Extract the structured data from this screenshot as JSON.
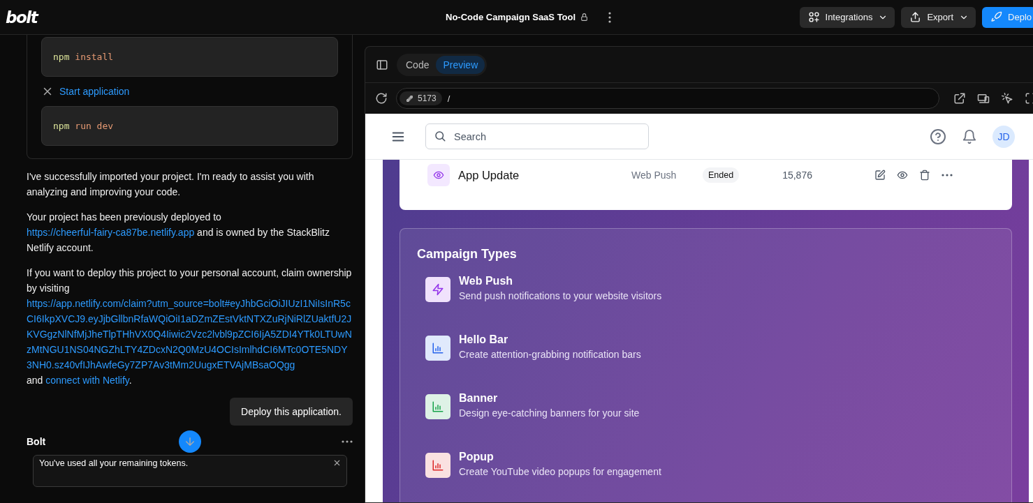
{
  "topbar": {
    "logo": "bolt",
    "project_title": "No-Code Campaign SaaS Tool",
    "buttons": [
      {
        "label": "Integrations",
        "kind": "menu"
      },
      {
        "label": "Export",
        "kind": "menu"
      },
      {
        "label": "Deplo",
        "kind": "primary"
      }
    ]
  },
  "chat": {
    "action_card": {
      "steps": [
        {
          "kind": "command",
          "command": "npm",
          "args": "install"
        },
        {
          "kind": "action",
          "label": "Start application"
        },
        {
          "kind": "command",
          "command": "npm",
          "args": "run dev"
        }
      ]
    },
    "assistant_paragraphs": [
      [
        {
          "text": "I've successfully imported your project. I'm ready to assist you with analyzing and improving your code."
        }
      ],
      [
        {
          "text": "Your project has been previously deployed to "
        },
        {
          "link": "https://cheerful-fairy-ca87be.netlify.app"
        },
        {
          "text": " and is owned by the StackBlitz Netlify account."
        }
      ],
      [
        {
          "text": "If you want to deploy this project to your personal account, claim ownership by visiting "
        },
        {
          "link": "https://app.netlify.com/claim?utm_source=bolt#eyJhbGciOiJIUzI1NiIsInR5cCI6IkpXVCJ9.eyJjbGllbnRfaWQiOiI1aDZmZEstVktNTXZuRjNiRlZUaktfU2JKVGgzNlNfMjJheTlpTHhVX0Q4Iiwic2Vzc2lvbl9pZCI6IjA5ZDI4YTk0LTUwNzMtNGU1NS04NGZhLTY4ZDcxN2Q0MzU4OCIsImlhdCI6MTc0OTE5NDY3NH0.sz40vfIJhAwfeGy7ZP7Av3tMm2UugxETVAjMBsaOQgg"
        },
        {
          "text": " and "
        },
        {
          "link": "connect with Netlify"
        },
        {
          "text": "."
        }
      ]
    ],
    "user_message": "Deploy this application.",
    "responder": "Bolt",
    "notice": {
      "text": "You've used all your remaining tokens."
    }
  },
  "workbench": {
    "tabs": [
      {
        "label": "Code",
        "selected": false
      },
      {
        "label": "Preview",
        "selected": true
      }
    ],
    "port": "5173",
    "path": "/",
    "preview": {
      "search": {
        "placeholder": "Search"
      },
      "avatar": "JD",
      "campaign_row": {
        "name": "App Update",
        "type": "Web Push",
        "status": "Ended",
        "count": "15,876"
      },
      "campaign_types": {
        "title": "Campaign Types",
        "items": [
          {
            "name": "Web Push",
            "description": "Send push notifications to your website visitors",
            "kind": "lightning",
            "color": "#9333ea"
          },
          {
            "name": "Hello Bar",
            "description": "Create attention-grabbing notification bars",
            "kind": "chart",
            "color": "#2563eb"
          },
          {
            "name": "Banner",
            "description": "Design eye-catching banners for your site",
            "kind": "chart",
            "color": "#16a34a"
          },
          {
            "name": "Popup",
            "description": "Create YouTube video popups for engagement",
            "kind": "chart",
            "color": "#dc2626"
          }
        ]
      }
    }
  }
}
